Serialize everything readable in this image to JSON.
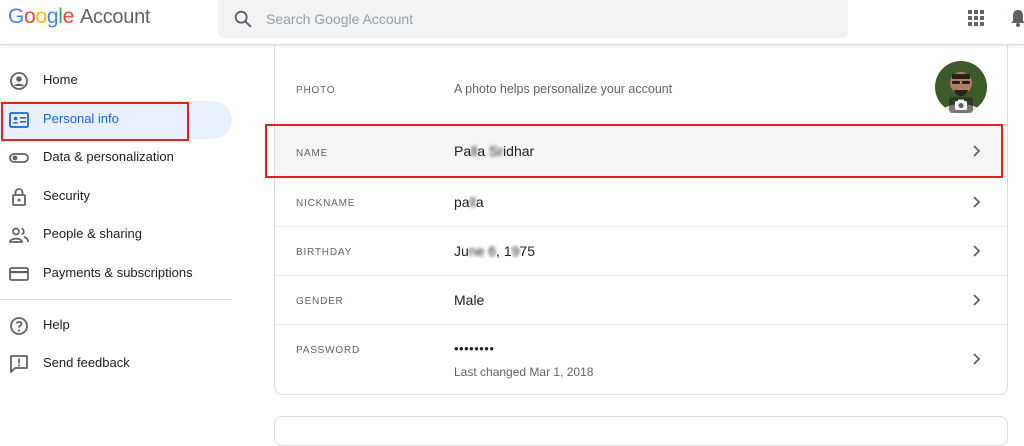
{
  "header": {
    "logo_letters": [
      "G",
      "o",
      "o",
      "g",
      "l",
      "e"
    ],
    "account_word": "Account",
    "search_placeholder": "Search Google Account",
    "icons": [
      "search-icon",
      "apps-grid-icon",
      "notifications-icon"
    ]
  },
  "sidebar": {
    "items": [
      {
        "label": "Home",
        "icon": "home-account-icon"
      },
      {
        "label": "Personal info",
        "icon": "id-card-icon",
        "active": true
      },
      {
        "label": "Data & personalization",
        "icon": "toggle-icon"
      },
      {
        "label": "Security",
        "icon": "lock-icon"
      },
      {
        "label": "People & sharing",
        "icon": "people-icon"
      },
      {
        "label": "Payments & subscriptions",
        "icon": "credit-card-icon"
      }
    ],
    "secondary": [
      {
        "label": "Help",
        "icon": "help-icon"
      },
      {
        "label": "Send feedback",
        "icon": "feedback-icon"
      }
    ]
  },
  "profile": {
    "photo_label": "PHOTO",
    "photo_text": "A photo helps personalize your account",
    "name_label": "NAME",
    "name_part1": "Pa",
    "name_blur1": "ll",
    "name_part2": "a ",
    "name_blur2": "Sr",
    "name_part3": "idhar",
    "nickname_label": "NICKNAME",
    "nickname_part1": "pa",
    "nickname_blur": "ll",
    "nickname_part2": "a",
    "birthday_label": "BIRTHDAY",
    "birthday_part1": "Ju",
    "birthday_blur1": "ne 6",
    "birthday_part2": ", 1",
    "birthday_blur2": "9",
    "birthday_part3": "75",
    "gender_label": "GENDER",
    "gender_value": "Male",
    "password_label": "PASSWORD",
    "password_value": "••••••••",
    "password_changed": "Last changed Mar 1, 2018"
  },
  "colors": {
    "accent": "#1967d2",
    "active_bg": "#e8f0fe",
    "highlight_box": "#e2231a"
  }
}
